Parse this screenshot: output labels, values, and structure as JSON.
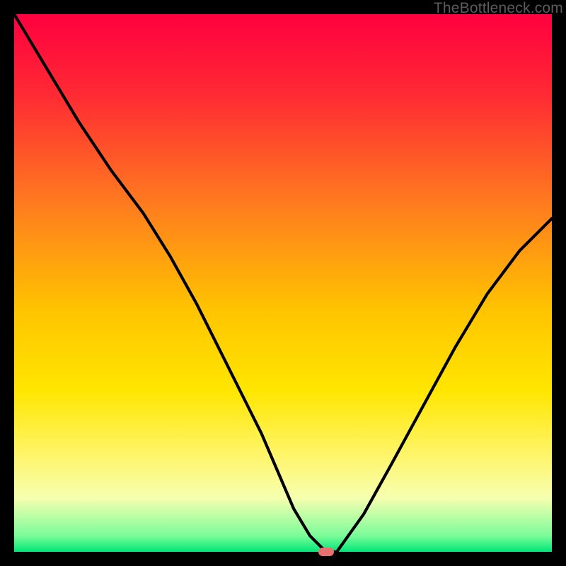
{
  "watermark": "TheBottleneck.com",
  "chart_data": {
    "type": "line",
    "title": "",
    "xlabel": "",
    "ylabel": "",
    "xlim": [
      0,
      100
    ],
    "ylim": [
      0,
      100
    ],
    "legend": false,
    "grid": false,
    "background_gradient": [
      {
        "pos": 0.0,
        "color": "#ff0040"
      },
      {
        "pos": 0.15,
        "color": "#ff2a33"
      },
      {
        "pos": 0.35,
        "color": "#ff7a1f"
      },
      {
        "pos": 0.55,
        "color": "#ffc400"
      },
      {
        "pos": 0.7,
        "color": "#ffe600"
      },
      {
        "pos": 0.82,
        "color": "#fff56a"
      },
      {
        "pos": 0.9,
        "color": "#f6ffb0"
      },
      {
        "pos": 0.97,
        "color": "#7cfc9a"
      },
      {
        "pos": 1.0,
        "color": "#00e676"
      }
    ],
    "series": [
      {
        "name": "bottleneck-curve",
        "color": "#000000",
        "x": [
          0,
          6,
          12,
          18,
          24,
          29,
          34,
          38,
          42,
          46,
          49,
          52,
          55,
          58,
          60,
          65,
          70,
          76,
          82,
          88,
          94,
          100
        ],
        "y": [
          100,
          90,
          80,
          71,
          63,
          55,
          46,
          38,
          30,
          22,
          15,
          8,
          3,
          0,
          0,
          7,
          16,
          27,
          38,
          48,
          56,
          62
        ]
      }
    ],
    "marker": {
      "x": 58,
      "y": 0,
      "color": "#e8716f"
    }
  }
}
